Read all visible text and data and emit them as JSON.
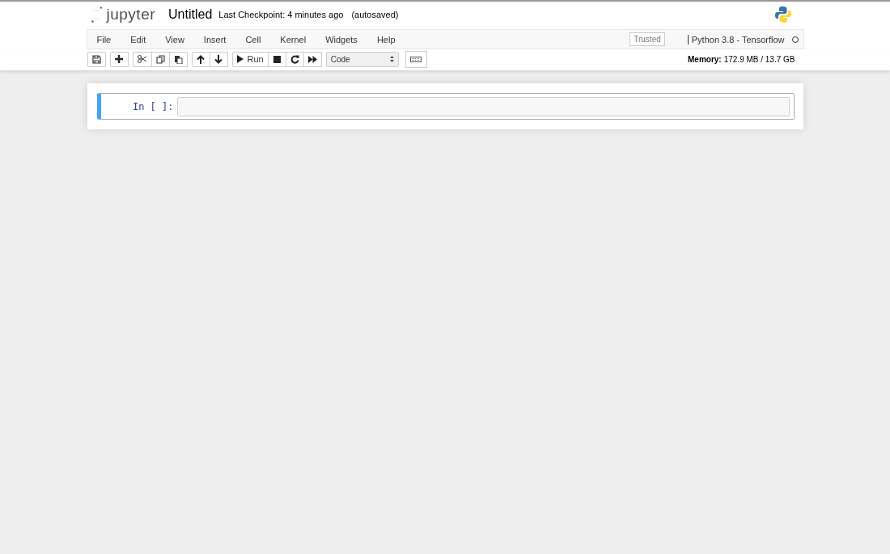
{
  "header": {
    "logo_text": "jupyter",
    "notebook_title": "Untitled",
    "checkpoint": "Last Checkpoint: 4 minutes ago",
    "autosave": "(autosaved)"
  },
  "menubar": {
    "items": [
      "File",
      "Edit",
      "View",
      "Insert",
      "Cell",
      "Kernel",
      "Widgets",
      "Help"
    ],
    "trusted": "Trusted",
    "kernel_name": "Python 3.8 - Tensorflow",
    "kernel_busy": false
  },
  "toolbar": {
    "groups": [
      [
        {
          "kind": "save"
        }
      ],
      [
        {
          "kind": "add"
        }
      ],
      [
        {
          "kind": "cut"
        },
        {
          "kind": "copy"
        },
        {
          "kind": "paste"
        }
      ],
      [
        {
          "kind": "up"
        },
        {
          "kind": "down"
        }
      ],
      [
        {
          "kind": "run",
          "label": "Run"
        },
        {
          "kind": "stop"
        },
        {
          "kind": "restart"
        },
        {
          "kind": "fast-forward"
        }
      ]
    ],
    "cell_type": "Code",
    "memory_label": "Memory:",
    "memory_value": "172.9 MB / 13.7 GB"
  },
  "cells": [
    {
      "prompt": "In [ ]:",
      "selected": true
    }
  ]
}
